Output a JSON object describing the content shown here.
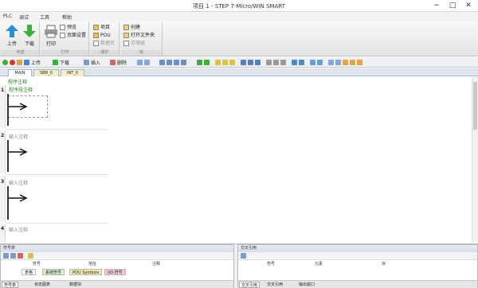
{
  "window": {
    "title": "项目 1 - STEP 7-Micro/WIN SMART"
  },
  "menu": [
    "PLC",
    "调试",
    "工具",
    "帮助"
  ],
  "ribbon": {
    "groups": [
      {
        "label": "传送",
        "buttons": [
          {
            "label": "上传"
          },
          {
            "label": "下载"
          }
        ]
      },
      {
        "label": "打印",
        "buttons": [
          {
            "label": "打印"
          }
        ],
        "small": [
          "预览",
          "页面设置"
        ]
      },
      {
        "label": "保护",
        "small": [
          "项目",
          "POU",
          "数据页"
        ]
      },
      {
        "label": "库",
        "small": [
          "创建",
          "打开文件夹",
          "存储器"
        ]
      }
    ]
  },
  "toolbar": {
    "upload": "上传",
    "download": "下载",
    "insert": "插入",
    "delete": "删除"
  },
  "editor_tabs": [
    "MAIN",
    "SBR_0",
    "INT_0"
  ],
  "editor": {
    "program_comment": "程序注释",
    "networks": [
      {
        "number": "1",
        "comment": "程序段注释"
      },
      {
        "number": "2",
        "comment": "输入注释"
      },
      {
        "number": "3",
        "comment": "输入注释"
      },
      {
        "number": "4",
        "comment": "输入注释"
      }
    ]
  },
  "symbol_pane": {
    "title": "符号表",
    "columns": [
      "",
      "符号",
      "地址",
      "注释"
    ],
    "sheet_tabs": [
      "表格",
      "系统符号",
      "POU Symbols",
      "I/O 符号"
    ],
    "bottom_tabs": [
      "符号表",
      "状态图表",
      "数据块"
    ]
  },
  "cross_pane": {
    "title": "交叉引用",
    "columns": [
      "",
      "符号",
      "元素",
      "块"
    ],
    "bottom_tabs": [
      "交叉引用",
      "交叉引用",
      "输出窗口"
    ]
  }
}
